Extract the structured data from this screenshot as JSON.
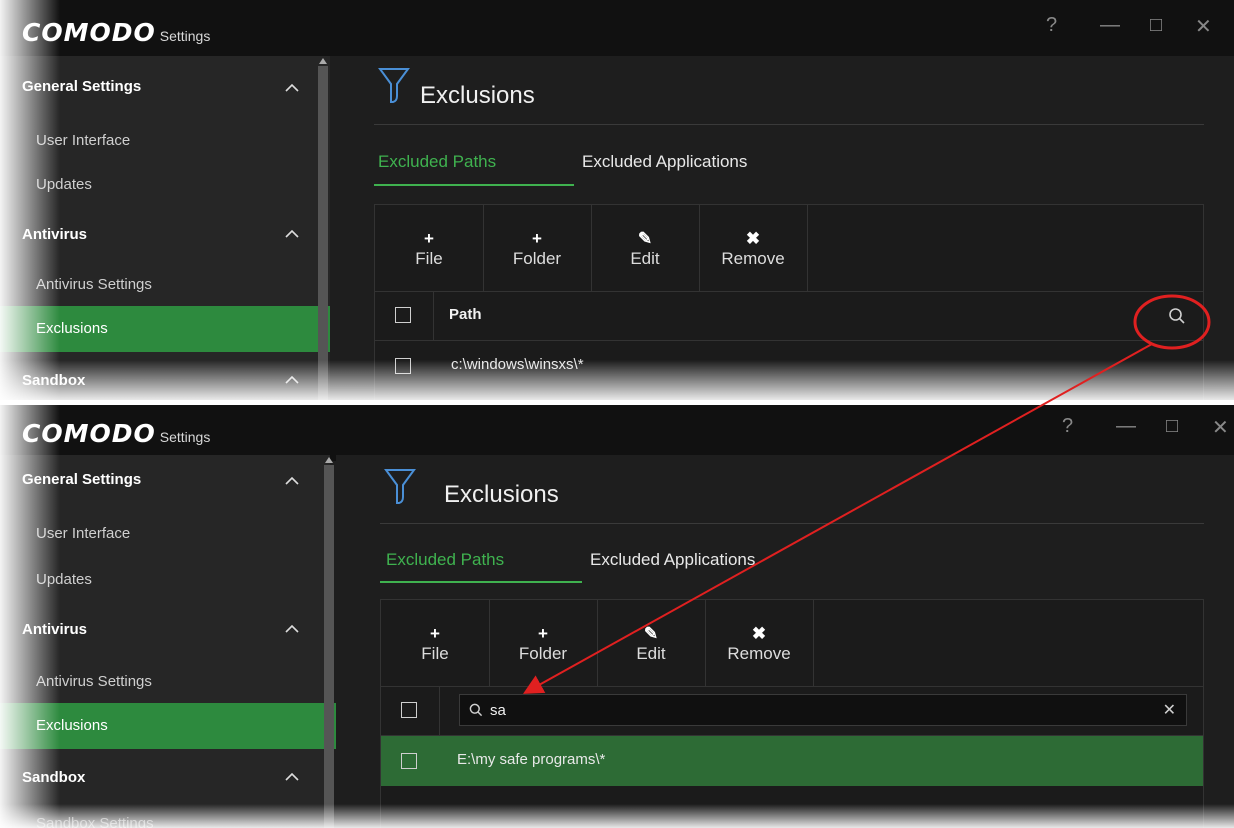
{
  "app": {
    "brand": "COMODO",
    "subtitle": "Settings"
  },
  "window_controls": {
    "help": "?",
    "minimize": "—",
    "maximize": "□",
    "close": "✕"
  },
  "sidebar_top": {
    "general_settings": "General Settings",
    "user_interface": "User Interface",
    "updates": "Updates",
    "antivirus": "Antivirus",
    "antivirus_settings": "Antivirus Settings",
    "exclusions": "Exclusions",
    "sandbox": "Sandbox"
  },
  "sidebar_bottom": {
    "general_settings": "General Settings",
    "user_interface": "User Interface",
    "updates": "Updates",
    "antivirus": "Antivirus",
    "antivirus_settings": "Antivirus Settings",
    "exclusions": "Exclusions",
    "sandbox": "Sandbox",
    "sandbox_settings": "Sandbox Settings"
  },
  "page": {
    "title": "Exclusions"
  },
  "tabs": {
    "excluded_paths": "Excluded Paths",
    "excluded_applications": "Excluded Applications"
  },
  "toolbar": {
    "file": "File",
    "folder": "Folder",
    "edit": "Edit",
    "remove": "Remove"
  },
  "toolbar_icons": {
    "file": "+",
    "folder": "+",
    "edit": "✎",
    "remove": "✖"
  },
  "table": {
    "column_path": "Path",
    "row_top": "c:\\windows\\winsxs\\*",
    "row_bottom": "E:\\my safe programs\\*"
  },
  "search": {
    "value": "sa",
    "clear": "✕"
  },
  "colors": {
    "accent_green": "#3fb24f",
    "selected_bg": "#2d8a3e",
    "annotation_red": "#e02020"
  }
}
